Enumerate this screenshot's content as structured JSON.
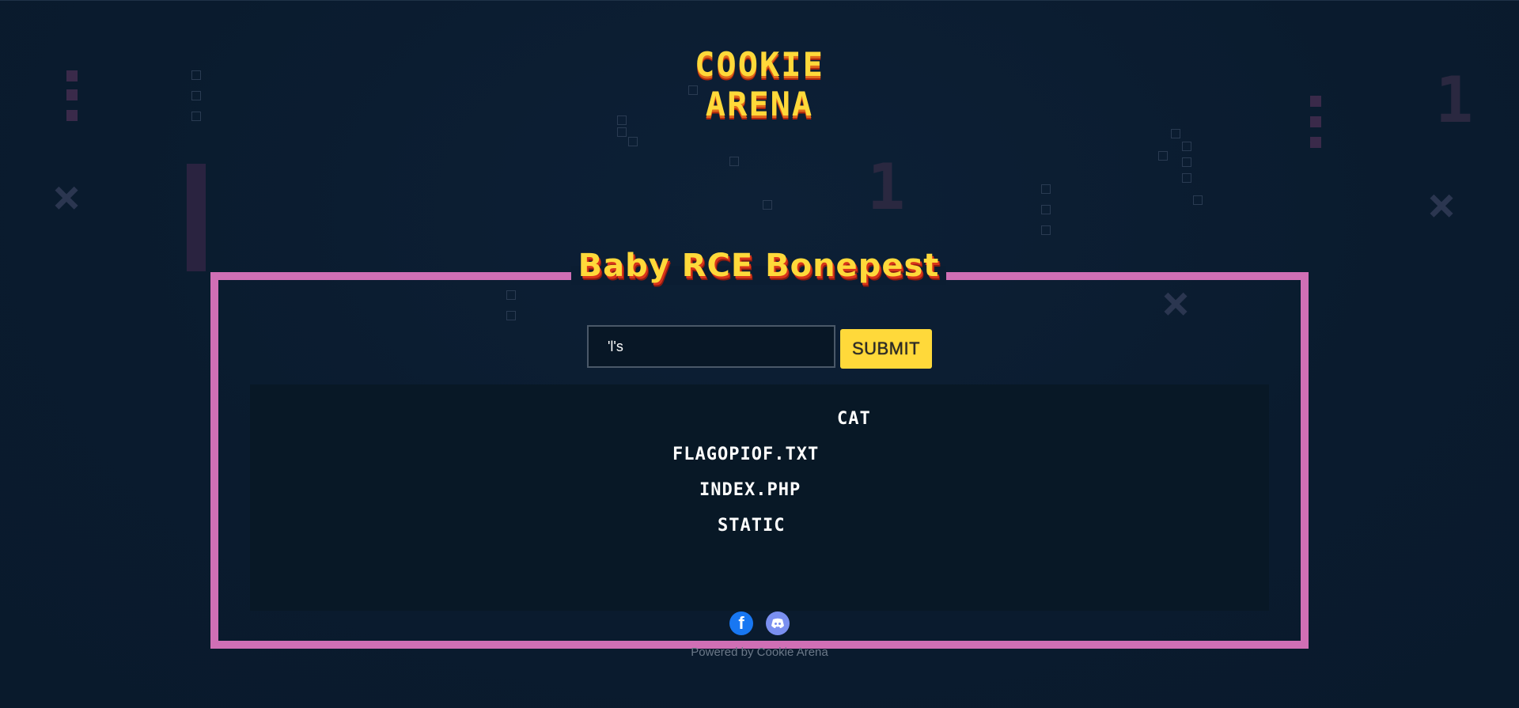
{
  "logo": {
    "line1": "COOKIE",
    "line2": "ARENA"
  },
  "challenge": {
    "title": "Baby RCE Bonepest"
  },
  "command_form": {
    "input_value": "'l's",
    "submit_label": "SUBMIT"
  },
  "output": {
    "lines": [
      "CAT",
      "FLAGOPIOF.TXT",
      "INDEX.PHP",
      "STATIC"
    ]
  },
  "social": {
    "facebook_icon": "facebook-icon",
    "discord_icon": "discord-icon"
  },
  "footer": {
    "text": "Powered by Cookie Arena"
  },
  "colors": {
    "background": "#0b1d32",
    "frame": "#d06fb5",
    "accent_yellow": "#ffd93a",
    "facebook": "#1877f2",
    "discord": "#7a8ff0"
  }
}
